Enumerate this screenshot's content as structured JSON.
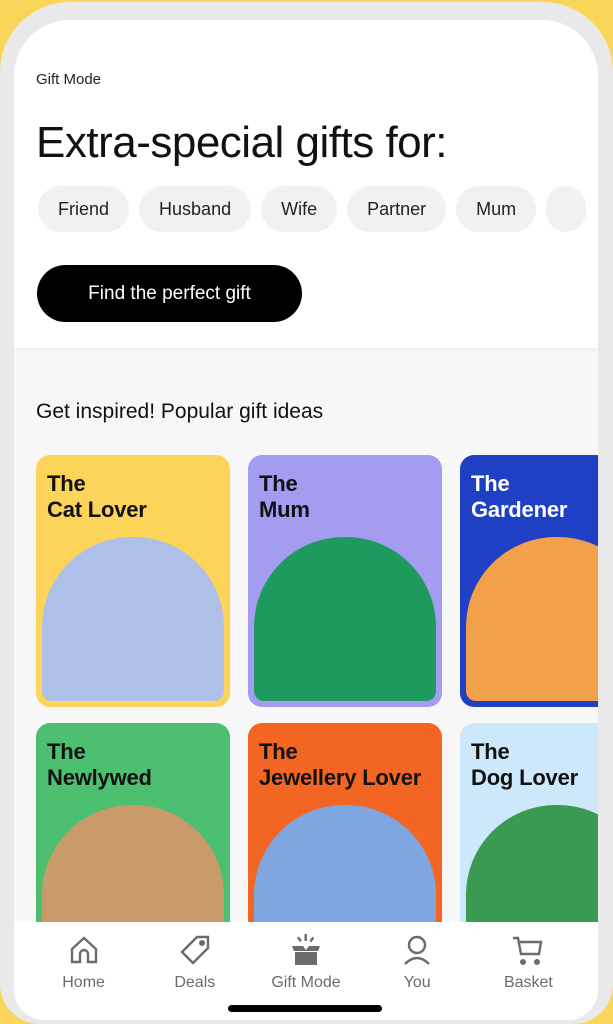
{
  "header": {
    "eyebrow": "Gift Mode",
    "headline": "Extra-special gifts for:"
  },
  "chips": [
    "Friend",
    "Husband",
    "Wife",
    "Partner",
    "Mum"
  ],
  "cta": "Find the perfect gift",
  "section_title": "Get inspired! Popular gift ideas",
  "cards": [
    {
      "title": "The\nCat Lover",
      "color": "#fcd45a",
      "image_color": "#aebfe8"
    },
    {
      "title": "The\nMum",
      "color": "#a39cf0",
      "image_color": "#1e9a5e"
    },
    {
      "title": "The\nGardener",
      "color": "#1f3fc4",
      "image_color": "#f2a04a"
    },
    {
      "title": "The\nNewlywed",
      "color": "#4cc070",
      "image_color": "#c99a6a"
    },
    {
      "title": "The\nJewellery Lover",
      "color": "#f26522",
      "image_color": "#7fa6e0"
    },
    {
      "title": "The\nDog Lover",
      "color": "#cde8fa",
      "image_color": "#3b9a52"
    }
  ],
  "nav": [
    {
      "label": "Home",
      "icon": "home-icon"
    },
    {
      "label": "Deals",
      "icon": "tag-icon"
    },
    {
      "label": "Gift Mode",
      "icon": "gift-box-icon"
    },
    {
      "label": "You",
      "icon": "user-icon"
    },
    {
      "label": "Basket",
      "icon": "cart-icon"
    }
  ]
}
